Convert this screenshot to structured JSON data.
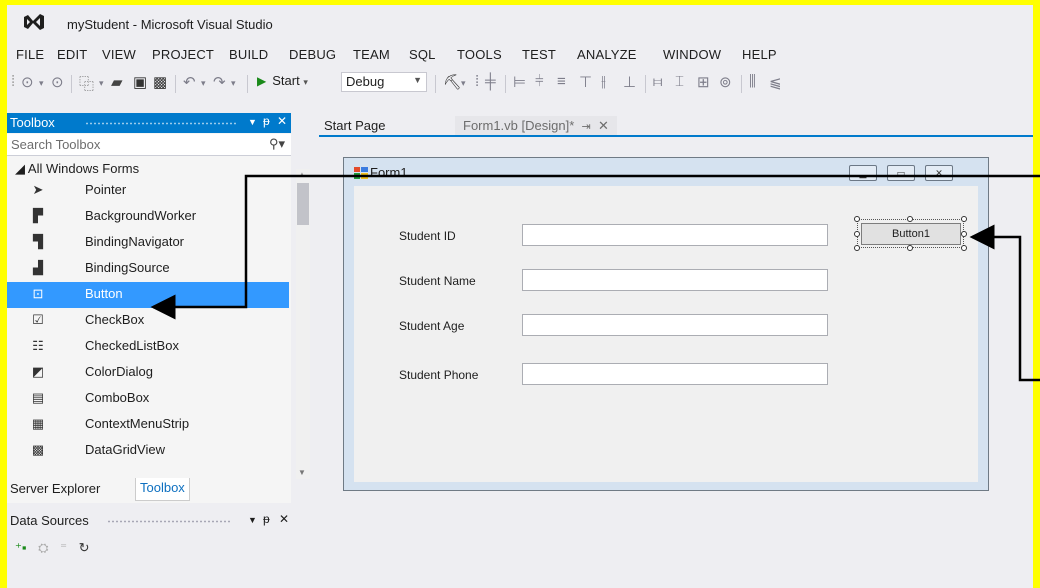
{
  "window": {
    "title": "myStudent - Microsoft Visual Studio"
  },
  "menu": [
    "FILE",
    "EDIT",
    "VIEW",
    "PROJECT",
    "BUILD",
    "DEBUG",
    "TEAM",
    "SQL",
    "TOOLS",
    "TEST",
    "ANALYZE",
    "WINDOW",
    "HELP"
  ],
  "toolbar": {
    "start_label": "Start",
    "config_value": "Debug"
  },
  "toolbox": {
    "title": "Toolbox",
    "search_placeholder": "Search Toolbox",
    "group": "◢ All Windows Forms",
    "items": [
      {
        "label": "Pointer",
        "icon": "pointer-icon"
      },
      {
        "label": "BackgroundWorker",
        "icon": "background-worker-icon"
      },
      {
        "label": "BindingNavigator",
        "icon": "binding-navigator-icon"
      },
      {
        "label": "BindingSource",
        "icon": "binding-source-icon"
      },
      {
        "label": "Button",
        "icon": "button-icon",
        "selected": true
      },
      {
        "label": "CheckBox",
        "icon": "checkbox-icon"
      },
      {
        "label": "CheckedListBox",
        "icon": "checked-list-box-icon"
      },
      {
        "label": "ColorDialog",
        "icon": "color-dialog-icon"
      },
      {
        "label": "ComboBox",
        "icon": "combobox-icon"
      },
      {
        "label": "ContextMenuStrip",
        "icon": "context-menu-strip-icon"
      },
      {
        "label": "DataGridView",
        "icon": "data-grid-view-icon"
      }
    ],
    "bottom_tabs": [
      "Server Explorer",
      "Toolbox"
    ]
  },
  "data_sources": {
    "title": "Data Sources"
  },
  "doc_tabs": [
    "Start Page",
    "Form1.vb [Design]*"
  ],
  "form": {
    "title": "Form1",
    "fields": [
      {
        "label": "Student ID",
        "value": ""
      },
      {
        "label": "Student Name",
        "value": ""
      },
      {
        "label": "Student Age",
        "value": ""
      },
      {
        "label": "Student Phone",
        "value": ""
      }
    ],
    "button_label": "Button1"
  },
  "colors": {
    "accent": "#007acc",
    "selection": "#3399ff",
    "annotation_border": "#ffff00"
  }
}
